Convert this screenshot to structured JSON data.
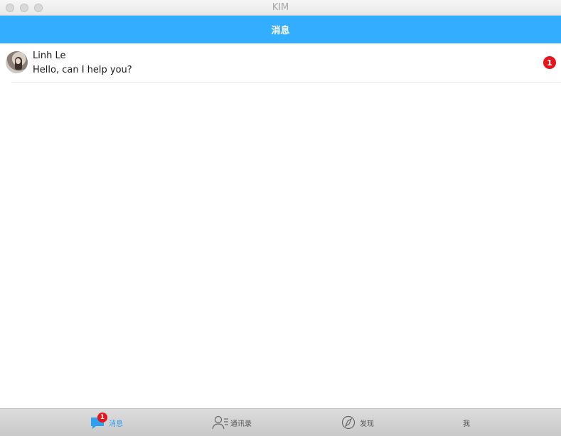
{
  "window": {
    "title": "KIM"
  },
  "header": {
    "title": "消息"
  },
  "conversations": [
    {
      "name": "Linh Le",
      "preview": "Hello, can I help you?",
      "unread": "1"
    }
  ],
  "tabbar": {
    "tabs": [
      {
        "label": "消息",
        "icon": "chat-bubble-icon",
        "badge": "1",
        "active": true
      },
      {
        "label": "通讯录",
        "icon": "contacts-icon"
      },
      {
        "label": "发现",
        "icon": "compass-icon"
      },
      {
        "label": "我"
      }
    ]
  },
  "colors": {
    "accent": "#33adff",
    "badge": "#e8141d"
  }
}
